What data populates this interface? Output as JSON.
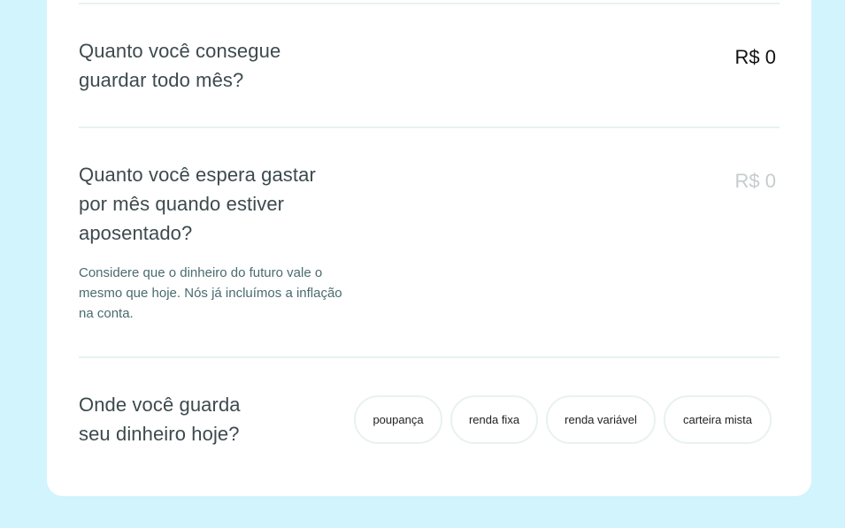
{
  "q1": {
    "lines": [
      "Quanto você consegue",
      "guardar todo mês?"
    ],
    "value": "R$ 0"
  },
  "q2": {
    "lines": [
      "Quanto você espera gastar",
      "por mês quando estiver",
      "aposentado?"
    ],
    "value": "R$ 0",
    "hint": [
      "Considere que o dinheiro do futuro vale o",
      "mesmo que hoje. Nós já incluímos a inflação",
      "na conta."
    ]
  },
  "q3": {
    "lines": [
      "Onde você guarda",
      "seu dinheiro hoje?"
    ],
    "options": [
      "poupança",
      "renda fixa",
      "renda variável",
      "carteira mista"
    ]
  }
}
